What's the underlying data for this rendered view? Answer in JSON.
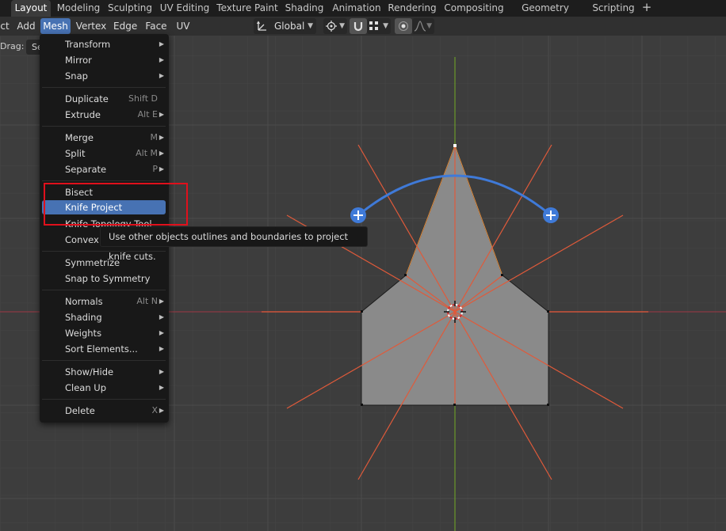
{
  "workspace_tabs": [
    "Layout",
    "Modeling",
    "Sculpting",
    "UV Editing",
    "Texture Paint",
    "Shading",
    "Animation",
    "Rendering",
    "Compositing",
    "Geometry Nodes",
    "Scripting"
  ],
  "add_workspace": "+",
  "header": {
    "menus": [
      "ct",
      "Add",
      "Mesh",
      "Vertex",
      "Edge",
      "Face",
      "UV"
    ],
    "orientation": "Global"
  },
  "toolsettings": {
    "drag_label": "Drag:",
    "drag_value": "Se"
  },
  "mesh_menu": [
    {
      "label": "Transform",
      "shortcut": "",
      "submenu": true
    },
    {
      "label": "Mirror",
      "shortcut": "",
      "submenu": true
    },
    {
      "label": "Snap",
      "shortcut": "",
      "submenu": true
    },
    {
      "label": "Duplicate",
      "shortcut": "Shift D",
      "submenu": false
    },
    {
      "label": "Extrude",
      "shortcut": "Alt E",
      "submenu": true
    },
    {
      "label": "Merge",
      "shortcut": "M",
      "submenu": true
    },
    {
      "label": "Split",
      "shortcut": "Alt M",
      "submenu": true
    },
    {
      "label": "Separate",
      "shortcut": "P",
      "submenu": true
    },
    {
      "label": "Bisect",
      "shortcut": "",
      "submenu": false
    },
    {
      "label": "Knife Project",
      "shortcut": "",
      "submenu": false
    },
    {
      "label": "Knife Topology Tool",
      "shortcut": "",
      "submenu": false
    },
    {
      "label": "Convex Hull",
      "shortcut": "",
      "submenu": false
    },
    {
      "label": "Symmetrize",
      "shortcut": "",
      "submenu": false
    },
    {
      "label": "Snap to Symmetry",
      "shortcut": "",
      "submenu": false
    },
    {
      "label": "Normals",
      "shortcut": "Alt N",
      "submenu": true
    },
    {
      "label": "Shading",
      "shortcut": "",
      "submenu": true
    },
    {
      "label": "Weights",
      "shortcut": "",
      "submenu": true
    },
    {
      "label": "Sort Elements...",
      "shortcut": "",
      "submenu": true
    },
    {
      "label": "Show/Hide",
      "shortcut": "",
      "submenu": true
    },
    {
      "label": "Clean Up",
      "shortcut": "",
      "submenu": true
    },
    {
      "label": "Delete",
      "shortcut": "X",
      "submenu": true
    }
  ],
  "highlighted_item": "Knife Project",
  "tooltip": "Use other objects outlines and boundaries to project knife cuts.",
  "colors": {
    "accent": "#4772b3",
    "viewport_bg": "#3d3d3d",
    "knife_lines": "#e05a3a",
    "gizmo": "#3f7ad8",
    "annotation_box": "#e0101c"
  }
}
